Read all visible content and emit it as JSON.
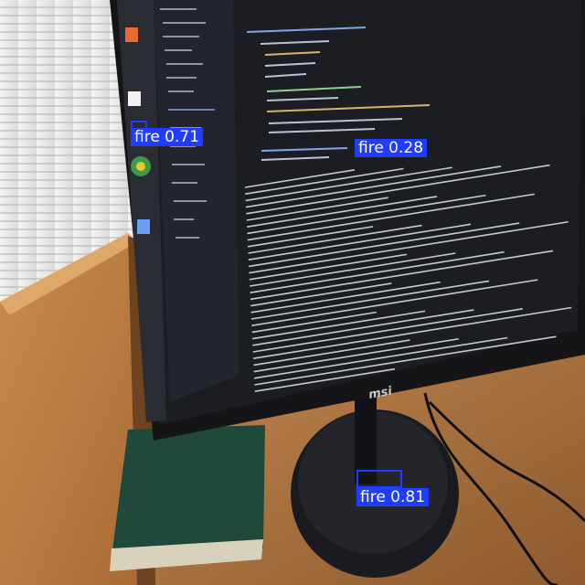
{
  "image": {
    "description": "Photo of an MSI monitor on a wooden desk showing a code editor and terminal log, with object-detection boxes overlaid",
    "monitor_brand": "msi"
  },
  "detections": [
    {
      "label": "fire 0.71",
      "class": "fire",
      "confidence": 0.71
    },
    {
      "label": "fire 0.28",
      "class": "fire",
      "confidence": 0.28
    },
    {
      "label": "fire 0.81",
      "class": "fire",
      "confidence": 0.81
    }
  ],
  "colors": {
    "detection_box": "#1f3cff",
    "detection_text": "#ffffff"
  }
}
